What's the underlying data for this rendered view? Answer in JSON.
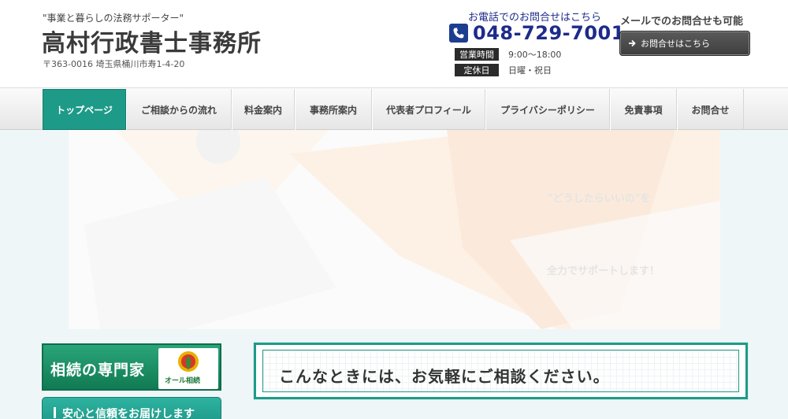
{
  "header": {
    "tagline": "\"事業と暮らしの法務サポーター\"",
    "site_title": "高村行政書士事務所",
    "address": "〒363-0016 埼玉県桶川市寿1-4-20",
    "phone": {
      "lead": "お電話でのお問合せはこちら",
      "number": "048-729-7001",
      "icon": "phone-icon"
    },
    "hours": [
      {
        "label": "営業時間",
        "value": "9:00〜18:00"
      },
      {
        "label": "定休日",
        "value": "日曜・祝日"
      }
    ],
    "mail": {
      "lead": "メールでのお問合せも可能",
      "button_label": "お問合せはこちら",
      "icon": "arrow-right-icon"
    }
  },
  "nav": {
    "items": [
      {
        "label": "トップページ",
        "active": true
      },
      {
        "label": "ご相談からの流れ"
      },
      {
        "label": "料金案内"
      },
      {
        "label": "事務所案内"
      },
      {
        "label": "代表者プロフィール"
      },
      {
        "label": "プライバシーポリシー"
      },
      {
        "label": "免責事項"
      },
      {
        "label": "お問合せ"
      }
    ]
  },
  "hero": {
    "line1": "\"どうしたらいいの\"を",
    "line2": "全力でサポートします！"
  },
  "sidebar": {
    "banner_title": "相続の専門家",
    "banner_logo_text": "オール相続",
    "button_label": "安心と信頼をお届けします"
  },
  "main": {
    "consult_heading": "こんなときには、お気軽にご相談ください。"
  },
  "colors": {
    "accent": "#1e9a88",
    "phone_text": "#1d2b8a",
    "banner_green": "#117a52"
  }
}
